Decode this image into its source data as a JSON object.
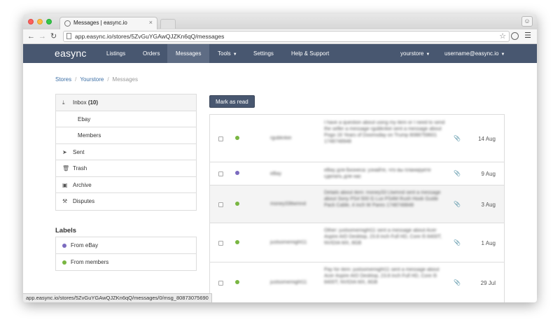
{
  "browser": {
    "tab_title": "Messages | easync.io",
    "tab_close": "×",
    "url": "app.easync.io/stores/5ZvGuYGAwQJZKn6qQ/messages",
    "status_url": "app.easync.io/stores/5ZvGuYGAwQJZKn6qQ/messages/0/msg_80873075690"
  },
  "navbar": {
    "logo": "easync",
    "items": [
      "Listings",
      "Orders",
      "Messages",
      "Tools",
      "Settings",
      "Help & Support"
    ],
    "active": "Messages",
    "store": "yourstore",
    "user": "username@easync.io"
  },
  "breadcrumb": [
    "Stores",
    "Yourstore",
    "Messages"
  ],
  "sidebar": {
    "items": [
      {
        "label": "Inbox",
        "count": "(10)",
        "icon": "inbox-icon"
      },
      {
        "label": "Ebay",
        "icon": ""
      },
      {
        "label": "Members",
        "icon": ""
      },
      {
        "label": "Sent",
        "icon": "paper-plane-icon"
      },
      {
        "label": "Trash",
        "icon": "trash-icon"
      },
      {
        "label": "Archive",
        "icon": "archive-icon"
      },
      {
        "label": "Disputes",
        "icon": "gavel-icon"
      }
    ],
    "labels_title": "Labels",
    "labels": [
      {
        "label": "From eBay",
        "color": "#7b6bbf"
      },
      {
        "label": "From members",
        "color": "#79b642"
      }
    ]
  },
  "main": {
    "mark_read_label": "Mark as read",
    "messages": [
      {
        "sender": "rgubknkei",
        "preview": "I have a question about using my item or I need to send the seller a message rgubknkei sent a message about Pogo 16 Years of Doomsday on Trump 8088759601 1748748948",
        "date": "14 Aug",
        "label_color": "#79b642"
      },
      {
        "sender": "eBay",
        "preview": "eBay для Бизнеса: узнайте, что вы планируете сделать для нас",
        "date": "9 Aug",
        "label_color": "#7b6bbf"
      },
      {
        "sender": "money33ltwmnd",
        "preview": "Details about item: money33 Ltwmnd sent a message about Sony PS4 500 G Lux PS4M Rush Hook Guide Pack Cable, 4 inch W Pares 1748748848",
        "date": "3 Aug",
        "label_color": "#79b642"
      },
      {
        "sender": "justsomemight11",
        "preview": "Other: justsomemight11 sent a message about Acer Aspire AIO Desktop, 23.8 inch Full HD, Core i5 8400T, NVIDIA MX, 8GB",
        "date": "1 Aug",
        "label_color": "#79b642"
      },
      {
        "sender": "justsomemight11",
        "preview": "Pay for item: justsomemight11 sent a message about Acer Aspire AIO Desktop, 23.8 inch Full HD, Core i5 8400T, NVIDIA MX, 8GB",
        "date": "29 Jul",
        "label_color": "#79b642"
      }
    ]
  }
}
